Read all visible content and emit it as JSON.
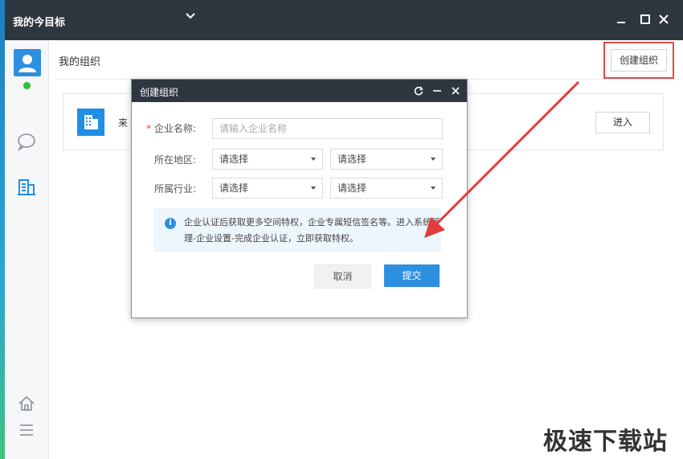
{
  "window": {
    "title": "我的今目标"
  },
  "main": {
    "heading": "我的组织",
    "create_button": "创建组织",
    "org_card": {
      "name_partial": "来",
      "enter_button": "进入"
    }
  },
  "modal": {
    "title": "创建组织",
    "company_name_label": "企业名称:",
    "company_name_required": "*",
    "company_name_placeholder": "请输入企业名称",
    "region_label": "所在地区:",
    "region_select_1": "请选择",
    "region_select_2": "请选择",
    "industry_label": "所属行业:",
    "industry_select_1": "请选择",
    "industry_select_2": "请选择",
    "notice_text": "企业认证后获取更多空间特权，企业专属短信签名等。进入系统管理-企业设置-完成企业认证，立即获取特权。",
    "cancel_button": "取消",
    "submit_button": "提交"
  },
  "watermark": "极速下载站",
  "colors": {
    "titlebar": "#2e3640",
    "accent": "#2d8fe0",
    "highlight": "#e04a4a",
    "online": "#29c13a"
  },
  "icons": {
    "chevron": "chevron-down-icon",
    "minimize": "minimize-icon",
    "maximize": "maximize-icon",
    "close": "close-icon",
    "refresh": "refresh-icon",
    "chat": "chat-bubble-icon",
    "org": "building-icon",
    "home": "home-icon",
    "menu": "menu-icon",
    "info": "info-icon"
  }
}
